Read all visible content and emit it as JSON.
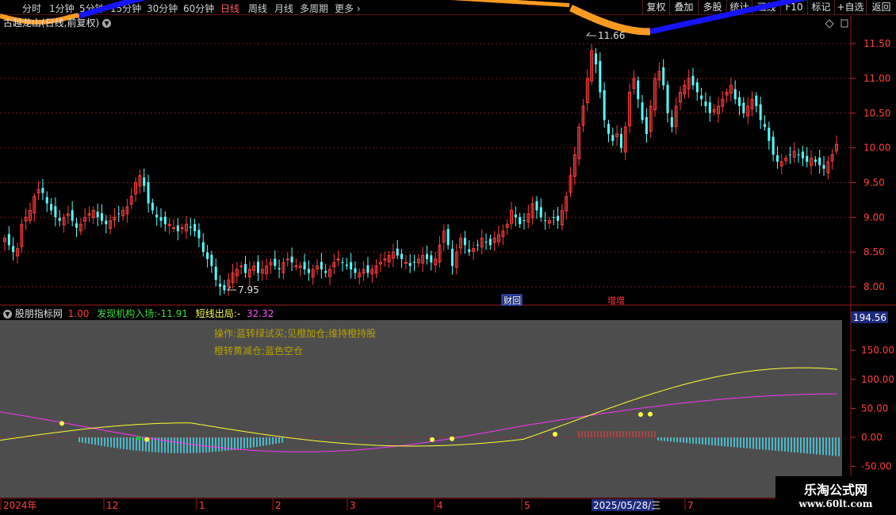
{
  "toolbar": {
    "periods": [
      "分时",
      "1分钟",
      "5分钟",
      "15分钟",
      "30分钟",
      "60分钟",
      "日线",
      "周线",
      "月线",
      "多周期",
      "更多"
    ],
    "active_period": "日线",
    "right_buttons": [
      "复权",
      "叠加",
      "多股",
      "统计",
      "画线",
      "F10",
      "标记",
      "+自选",
      "返回"
    ]
  },
  "price_panel": {
    "title": "古越龙山(日线,前复权)",
    "high_label": "11.66",
    "low_label": "7.95",
    "y_ticks": [
      "11.50",
      "11.00",
      "10.50",
      "10.00",
      "9.50",
      "9.00",
      "8.50",
      "8.00"
    ],
    "badge_finance": "财回",
    "badge_increase": "增增"
  },
  "indicator_panel": {
    "name": "股朋指标网",
    "value1": "1.00",
    "label_institution": "发现机构入场:",
    "value_institution": "-11.91",
    "label_short": "短线出局:",
    "value_short_dash": "-",
    "value_short": "32.32",
    "current_value": "194.56",
    "y_ticks": [
      "150.00",
      "100.00",
      "50.00",
      "0.00",
      "-50.00"
    ],
    "legend_line1": "操作:蓝转绿试买;见橙加仓;维持橙持股",
    "legend_line2": "橙转黄减仓;蓝色空仓"
  },
  "time_axis": {
    "labels": [
      "2024年",
      "12",
      "1",
      "2",
      "3",
      "4",
      "5",
      "2025/05/28/三",
      "7"
    ]
  },
  "watermark": {
    "line1": "乐淘公式网",
    "line2": "www.60lt.com"
  },
  "colors": {
    "up": "#ff3c3c",
    "down": "#54ffff",
    "grid": "#7a1a1a",
    "accent": "#ff5a5a"
  },
  "chart_data": {
    "type": "candlestick",
    "title": "古越龙山(日线,前复权)",
    "ylim": [
      7.8,
      11.8
    ],
    "closes": [
      8.7,
      8.6,
      8.5,
      8.55,
      8.9,
      9.0,
      9.1,
      9.3,
      9.4,
      9.35,
      9.2,
      9.1,
      9.0,
      8.95,
      9.0,
      9.05,
      8.95,
      8.85,
      8.9,
      9.0,
      9.05,
      9.1,
      9.0,
      8.95,
      8.9,
      8.95,
      9.0,
      9.05,
      9.1,
      9.15,
      9.3,
      9.5,
      9.6,
      9.45,
      9.2,
      9.1,
      9.0,
      8.95,
      8.9,
      8.9,
      8.85,
      8.8,
      8.85,
      8.9,
      8.85,
      8.8,
      8.7,
      8.5,
      8.4,
      8.3,
      8.1,
      8.0,
      7.95,
      8.1,
      8.2,
      8.25,
      8.3,
      8.2,
      8.25,
      8.3,
      8.2,
      8.25,
      8.3,
      8.35,
      8.3,
      8.25,
      8.35,
      8.4,
      8.35,
      8.3,
      8.3,
      8.25,
      8.2,
      8.25,
      8.3,
      8.25,
      8.2,
      8.25,
      8.35,
      8.4,
      8.35,
      8.3,
      8.25,
      8.2,
      8.2,
      8.25,
      8.2,
      8.25,
      8.3,
      8.35,
      8.4,
      8.45,
      8.5,
      8.45,
      8.4,
      8.35,
      8.3,
      8.35,
      8.4,
      8.45,
      8.4,
      8.35,
      8.4,
      8.6,
      8.8,
      8.6,
      8.3,
      8.5,
      8.7,
      8.6,
      8.5,
      8.55,
      8.6,
      8.7,
      8.65,
      8.6,
      8.7,
      8.75,
      8.8,
      8.9,
      9.1,
      9.0,
      8.9,
      8.95,
      9.05,
      9.2,
      9.1,
      9.0,
      8.95,
      8.95,
      9.0,
      8.95,
      9.1,
      9.3,
      9.6,
      9.9,
      10.3,
      10.6,
      11.0,
      11.4,
      11.2,
      10.8,
      10.4,
      10.2,
      10.1,
      10.2,
      10.0,
      10.3,
      10.8,
      11.0,
      10.7,
      10.4,
      10.2,
      10.6,
      11.0,
      11.1,
      10.9,
      10.5,
      10.3,
      10.6,
      10.8,
      10.9,
      11.0,
      10.9,
      10.8,
      10.7,
      10.6,
      10.5,
      10.55,
      10.6,
      10.7,
      10.8,
      10.9,
      10.7,
      10.6,
      10.5,
      10.6,
      10.7,
      10.6,
      10.4,
      10.3,
      10.1,
      9.9,
      9.8,
      9.8,
      9.85,
      9.9,
      9.95,
      9.9,
      9.85,
      9.8,
      9.85,
      9.8,
      9.75,
      9.7,
      9.8,
      9.9,
      10.05
    ]
  }
}
